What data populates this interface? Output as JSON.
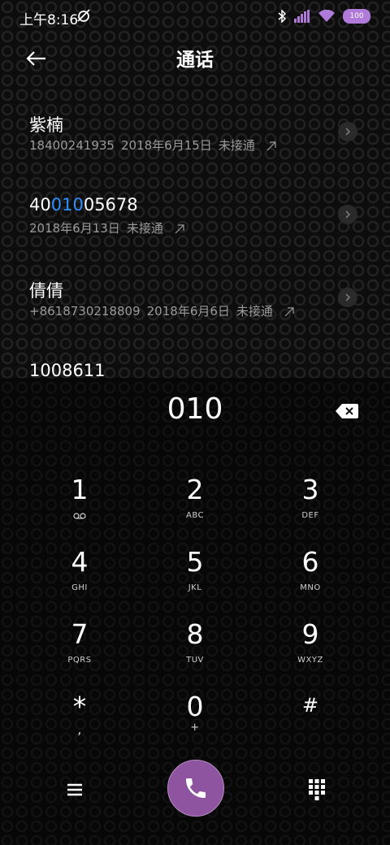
{
  "status_bar": {
    "time": "上午8:16",
    "battery": "100"
  },
  "header": {
    "title": "通话"
  },
  "calls": [
    {
      "name": "紫楠",
      "number": "18400241935",
      "date": "2018年6月15日",
      "status": "未接通"
    },
    {
      "name_pre": "40",
      "name_hl": "010",
      "name_post": "05678",
      "number": "",
      "date": "2018年6月13日",
      "status": "未接通"
    },
    {
      "name": "倩倩",
      "number": "+8618730218809",
      "date": "2018年6月6日",
      "status": "未接通"
    },
    {
      "name": "1008611"
    }
  ],
  "dialer": {
    "input": "010",
    "keys": [
      {
        "digit": "1",
        "letters": ""
      },
      {
        "digit": "2",
        "letters": "ABC"
      },
      {
        "digit": "3",
        "letters": "DEF"
      },
      {
        "digit": "4",
        "letters": "GHI"
      },
      {
        "digit": "5",
        "letters": "JKL"
      },
      {
        "digit": "6",
        "letters": "MNO"
      },
      {
        "digit": "7",
        "letters": "PQRS"
      },
      {
        "digit": "8",
        "letters": "TUV"
      },
      {
        "digit": "9",
        "letters": "WXYZ"
      },
      {
        "digit": "*",
        "letters": ","
      },
      {
        "digit": "0",
        "letters": "+"
      },
      {
        "digit": "#",
        "letters": ""
      }
    ]
  },
  "colors": {
    "accent": "#8f549f",
    "highlight": "#2f8fff",
    "battery": "#b07ad8"
  },
  "icons": [
    "back-arrow-icon",
    "backspace-icon",
    "voicemail-icon",
    "menu-icon",
    "phone-icon",
    "keypad-icon",
    "bluetooth-icon",
    "signal-icon",
    "wifi-icon",
    "alarm-off-icon"
  ]
}
